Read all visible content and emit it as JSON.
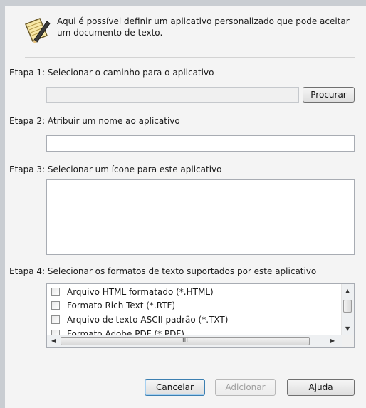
{
  "header": {
    "description": "Aqui é possível definir um aplicativo personalizado que pode aceitar um documento de texto."
  },
  "step1": {
    "label": "Etapa 1: Selecionar o caminho para o aplicativo",
    "path_value": "",
    "browse_label": "Procurar"
  },
  "step2": {
    "label": "Etapa 2: Atribuir um nome ao aplicativo",
    "name_value": ""
  },
  "step3": {
    "label": "Etapa 3: Selecionar um ícone para este aplicativo"
  },
  "step4": {
    "label": "Etapa 4: Selecionar os formatos de texto suportados por este aplicativo",
    "formats": [
      {
        "label": "Arquivo HTML formatado (*.HTML)",
        "checked": false
      },
      {
        "label": "Formato Rich Text (*.RTF)",
        "checked": false
      },
      {
        "label": "Arquivo de texto ASCII padrão (*.TXT)",
        "checked": false
      },
      {
        "label": "Formato Adobe PDF (*.PDF)",
        "checked": false
      }
    ],
    "hscroll_grip": "III"
  },
  "buttons": {
    "cancel": "Cancelar",
    "add": "Adicionar",
    "help": "Ajuda"
  }
}
